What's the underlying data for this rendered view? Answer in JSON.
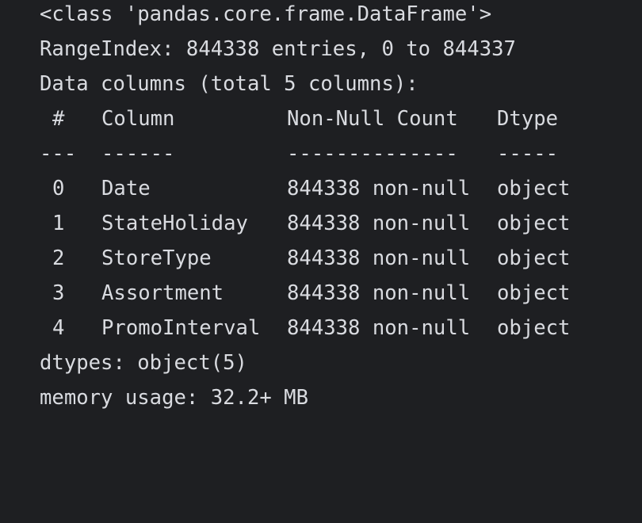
{
  "header": {
    "class_line": "<class 'pandas.core.frame.DataFrame'>",
    "range_index": "RangeIndex: 844338 entries, 0 to 844337",
    "data_columns": "Data columns (total 5 columns):"
  },
  "table": {
    "headers": {
      "num": "#",
      "column": "Column",
      "count": "Non-Null Count",
      "dtype": "Dtype"
    },
    "separators": {
      "num": "---",
      "column": "------",
      "count": "--------------",
      "dtype": "-----"
    },
    "rows": [
      {
        "num": "0",
        "column": "Date",
        "count": "844338 non-null",
        "dtype": "object"
      },
      {
        "num": "1",
        "column": "StateHoliday",
        "count": "844338 non-null",
        "dtype": "object"
      },
      {
        "num": "2",
        "column": "StoreType",
        "count": "844338 non-null",
        "dtype": "object"
      },
      {
        "num": "3",
        "column": "Assortment",
        "count": "844338 non-null",
        "dtype": "object"
      },
      {
        "num": "4",
        "column": "PromoInterval",
        "count": "844338 non-null",
        "dtype": "object"
      }
    ]
  },
  "footer": {
    "dtypes": "dtypes: object(5)",
    "memory": "memory usage: 32.2+ MB"
  }
}
